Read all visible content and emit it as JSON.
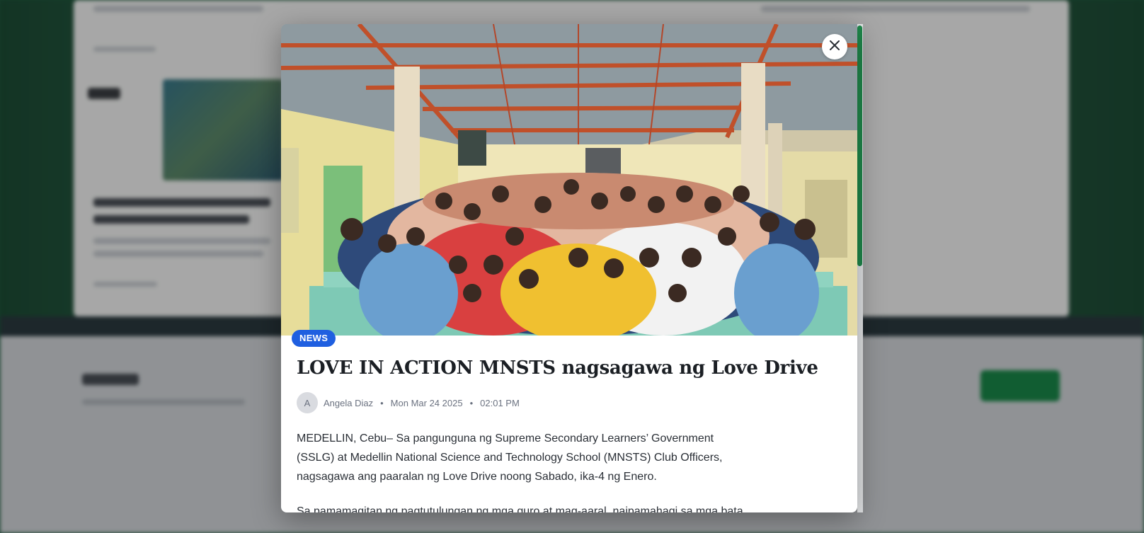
{
  "modal": {
    "badge": "NEWS",
    "title": "LOVE IN ACTION MNSTS nagsagawa ng Love Drive",
    "author_initial": "A",
    "author": "Angela Diaz",
    "date": "Mon Mar 24 2025",
    "time": "02:01 PM",
    "paragraphs": [
      "MEDELLIN, Cebu– Sa pangunguna ng Supreme Secondary Learners’ Government (SSLG) at Medellin National Science and Technology School (MNSTS) Club Officers, nagsagawa ang paaralan ng Love Drive noong Sabado, ika-4 ng Enero.",
      "Sa pamamagitan ng pagtutulungan ng mga guro at mag-aaral, naipamahagi sa mga bata"
    ]
  },
  "icons": {
    "close": "close-icon"
  },
  "colors": {
    "badge": "#1f5fe0",
    "scrollbar_thumb": "#1f8a4c"
  }
}
